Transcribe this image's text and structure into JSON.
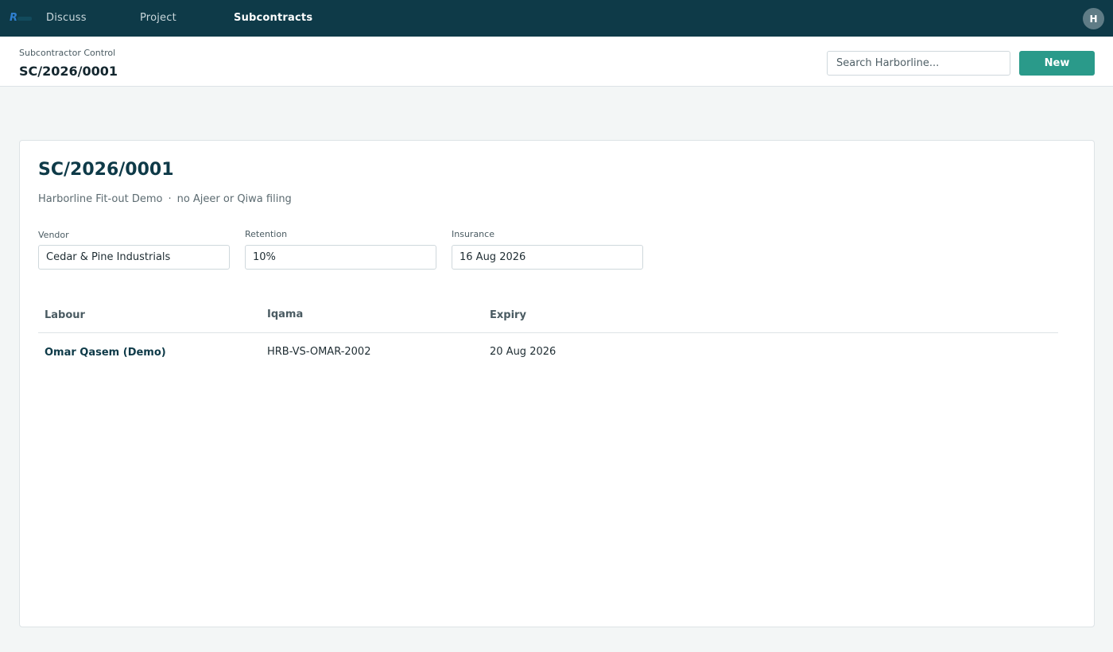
{
  "nav": {
    "items": [
      {
        "label": "Discuss",
        "active": false
      },
      {
        "label": "Project",
        "active": false
      },
      {
        "label": "Subcontracts",
        "active": true
      }
    ],
    "avatar_initial": "H",
    "logo_icon": "app-logo-icon"
  },
  "header": {
    "breadcrumb": "Subcontractor Control",
    "title": "SC/2026/0001",
    "search_placeholder": "Search Harborline...",
    "new_label": "New"
  },
  "record": {
    "title": "SC/2026/0001",
    "project": "Harborline Fit-out Demo",
    "separator": "·",
    "note": "no Ajeer or Qiwa filing",
    "fields": {
      "vendor": {
        "label": "Vendor",
        "value": "Cedar & Pine Industrials"
      },
      "retention": {
        "label": "Retention",
        "value": "10%"
      },
      "insurance": {
        "label": "Insurance",
        "value": "16 Aug 2026"
      }
    }
  },
  "labour_table": {
    "columns": [
      "Labour",
      "Iqama",
      "Expiry"
    ],
    "rows": [
      {
        "labour": "Omar Qasem (Demo)",
        "iqama": "HRB-VS-OMAR-2002",
        "expiry": "20 Aug 2026"
      }
    ]
  },
  "colors": {
    "nav_bg": "#0e3a48",
    "accent": "#2a9a8a",
    "page_bg": "#f3f6f6"
  }
}
